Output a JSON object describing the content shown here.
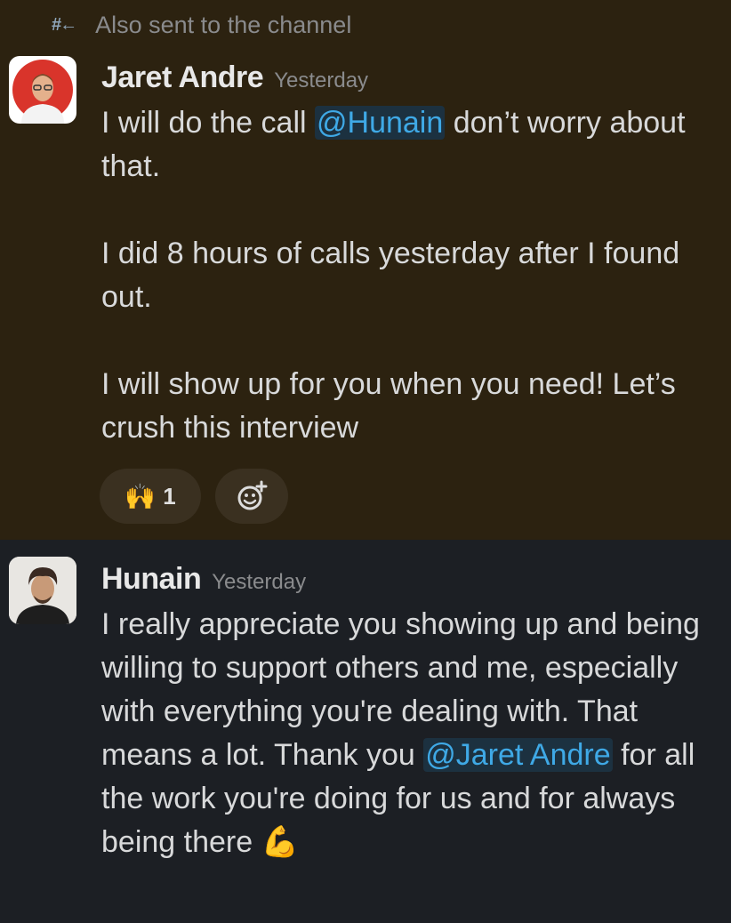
{
  "channel_note": {
    "icon": "#←",
    "text": "Also sent to the channel"
  },
  "messages": [
    {
      "author": "Jaret Andre",
      "time": "Yesterday",
      "para1_pre": "I will do the call ",
      "para1_mention": "@Hunain",
      "para1_post": " don’t worry about that.",
      "para2": "I did 8 hours of calls yesterday after I found out.",
      "para3": "I will show up for you when you need! Let’s crush this interview",
      "reaction": {
        "emoji": "🙌",
        "count": "1"
      }
    },
    {
      "author": "Hunain",
      "time": "Yesterday",
      "text_pre": "I really appreciate you showing up and being willing to support others and me, especially with everything you're dealing with. That means a lot. Thank you ",
      "mention": "@Jaret Andre",
      "text_post": " for all the work you're doing for us and for always being there",
      "emoji": "💪"
    }
  ],
  "colors": {
    "highlight_bg": "#2c2210",
    "normal_bg": "#1c1f24",
    "mention": "#3fa9e6"
  }
}
